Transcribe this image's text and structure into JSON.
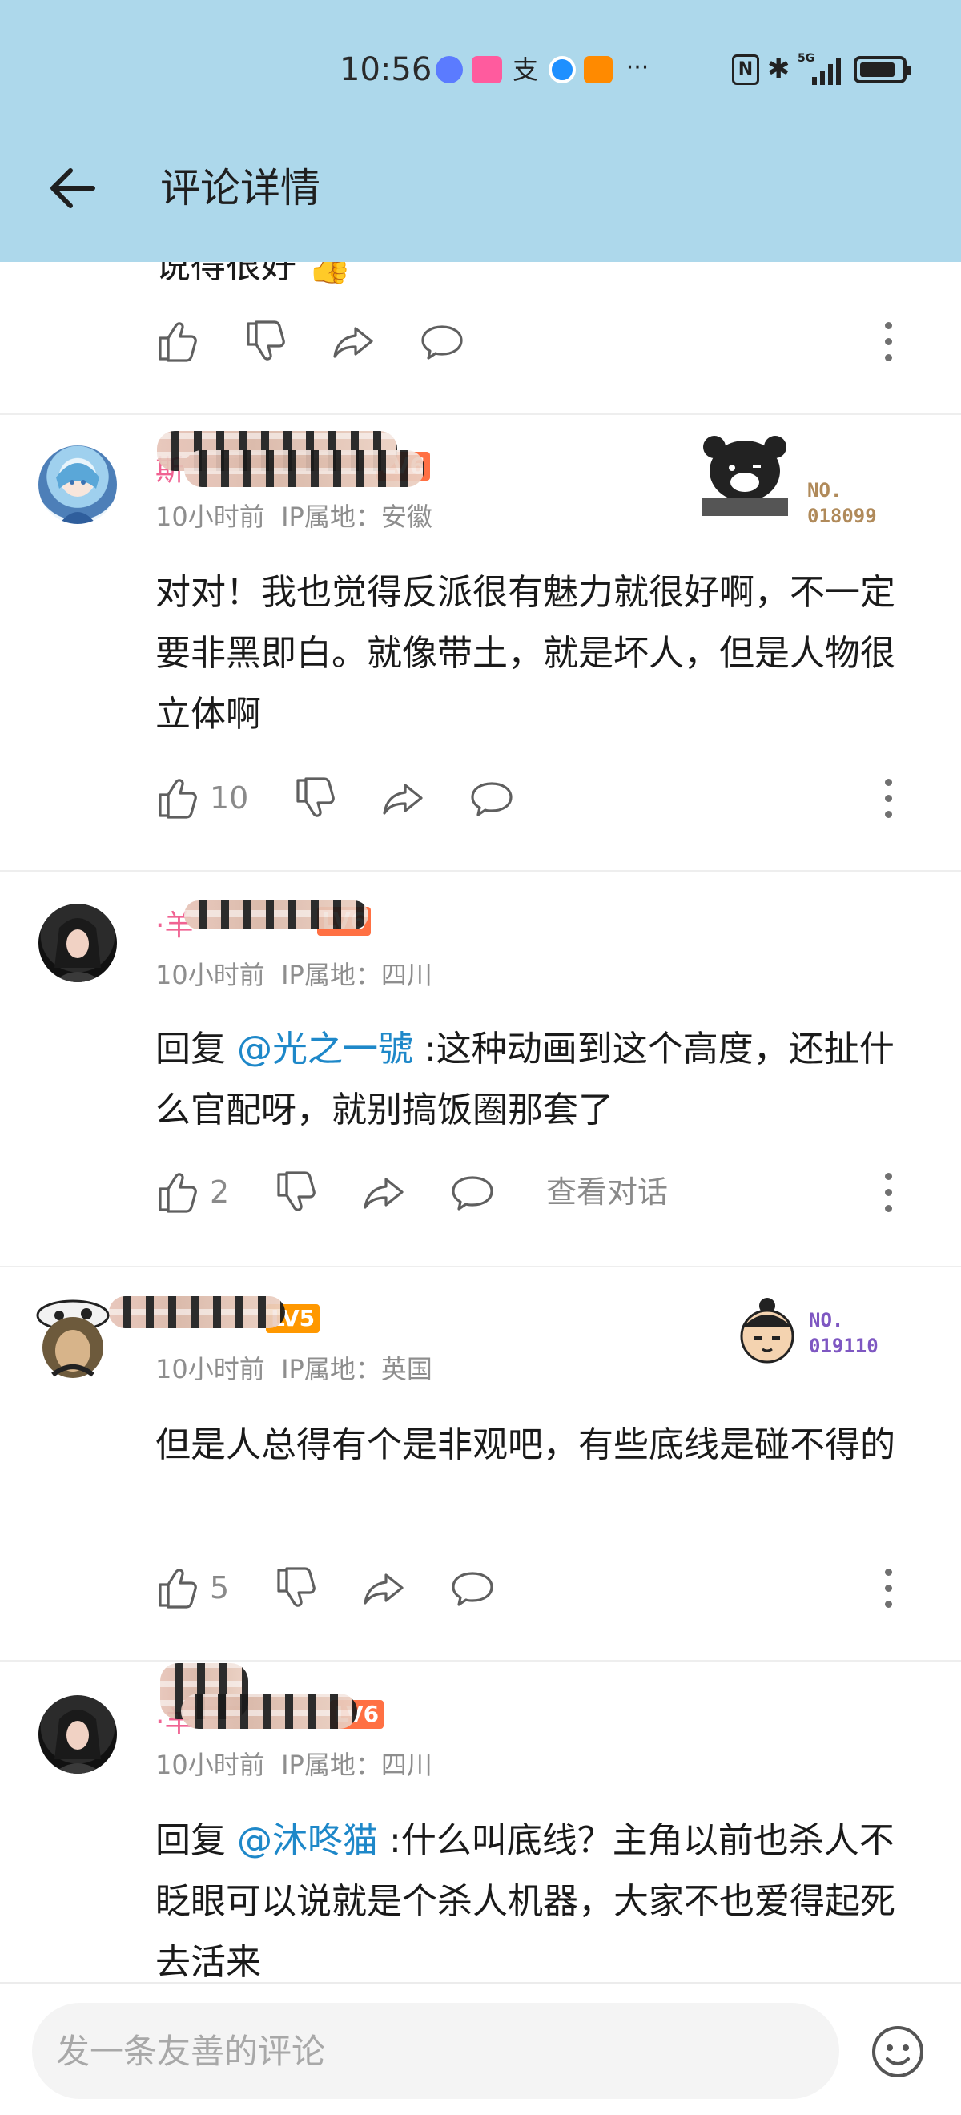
{
  "status_bar": {
    "time": "10:56",
    "notif_more": "···",
    "notif_zhi": "支",
    "nfc": "N",
    "bluetooth": "✱",
    "network": "5G",
    "battery_level": 0.85
  },
  "header": {
    "title": "评论详情",
    "back_icon": "arrow-left-icon"
  },
  "top_partial": {
    "text": "说得很好 👍"
  },
  "comments": [
    {
      "name_visible": "斯",
      "level": "LV6",
      "time": "10小时前",
      "ip": "IP属地：安徽",
      "text": "对对！我也觉得反派很有魅力就很好啊，不一定要非黑即白。就像带土，就是坏人，但是人物很立体啊",
      "likes": "10",
      "garb_no": "NO.\n018099"
    },
    {
      "name_visible": "·羊",
      "level": "LV6",
      "time": "10小时前",
      "ip": "IP属地：四川",
      "reply_prefix": "回复 ",
      "mention": "@光之一號",
      "text": " :这种动画到这个高度，还扯什么官配呀，就别搞饭圈那套了",
      "likes": "2",
      "view_conversation": "查看对话"
    },
    {
      "name_visible": "",
      "level": "LV5",
      "time": "10小时前",
      "ip": "IP属地：英国",
      "text": "但是人总得有个是非观吧，有些底线是碰不得的",
      "likes": "5",
      "garb_no": "NO.\n019110"
    },
    {
      "name_visible": "·羊",
      "level": "LV6",
      "time": "10小时前",
      "ip": "IP属地：四川",
      "reply_prefix": "回复 ",
      "mention": "@沐咚猫",
      "text": " :什么叫底线？主角以前也杀人不眨眼可以说就是个杀人机器，大家不也爱得起死去活来"
    }
  ],
  "composer": {
    "placeholder": "发一条友善的评论",
    "emoji_icon": "smiley-icon"
  },
  "colors": {
    "header_bg": "#add8eb",
    "mention": "#1e88c9",
    "username_pink": "#f06292",
    "level_badge": "#ff7043",
    "meta_gray": "#8e8e8e"
  }
}
